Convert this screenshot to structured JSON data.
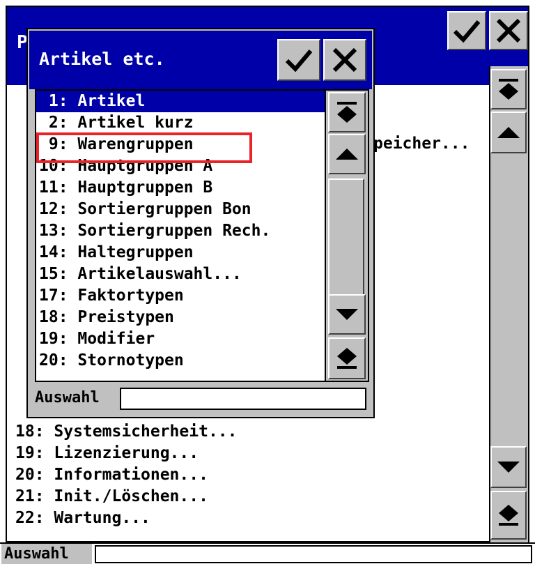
{
  "background_window": {
    "title_char": "P",
    "peek_text": "peicher...",
    "items": [
      "18: Systemsicherheit...",
      "19: Lizenzierung...",
      "20: Informationen...",
      "21: Init./Löschen...",
      "22: Wartung..."
    ],
    "footer_label": "Auswahl",
    "footer_value": ""
  },
  "dialog": {
    "title": "Artikel etc.",
    "items": [
      {
        "text": " 1: Artikel",
        "selected": true
      },
      {
        "text": " 2: Artikel kurz",
        "selected": false
      },
      {
        "text": " 9: Warengruppen",
        "selected": false
      },
      {
        "text": "10: Hauptgruppen A",
        "selected": false
      },
      {
        "text": "11: Hauptgruppen B",
        "selected": false
      },
      {
        "text": "12: Sortiergruppen Bon",
        "selected": false
      },
      {
        "text": "13: Sortiergruppen Rech.",
        "selected": false
      },
      {
        "text": "14: Haltegruppen",
        "selected": false
      },
      {
        "text": "15: Artikelauswahl...",
        "selected": false
      },
      {
        "text": "17: Faktortypen",
        "selected": false
      },
      {
        "text": "18: Preistypen",
        "selected": false
      },
      {
        "text": "19: Modifier",
        "selected": false
      },
      {
        "text": "20: Stornotypen",
        "selected": false
      }
    ],
    "footer_label": "Auswahl",
    "footer_value": ""
  },
  "icons": {
    "confirm": "checkmark-icon",
    "cancel": "x-icon",
    "top": "scroll-top-icon",
    "up": "scroll-up-icon",
    "down": "scroll-down-icon",
    "bottom": "scroll-bottom-icon"
  },
  "colors": {
    "titlebar": "#0000a8",
    "selection": "#0000a8",
    "highlight": "#e8232a",
    "button_face": "#c0c0c0"
  }
}
